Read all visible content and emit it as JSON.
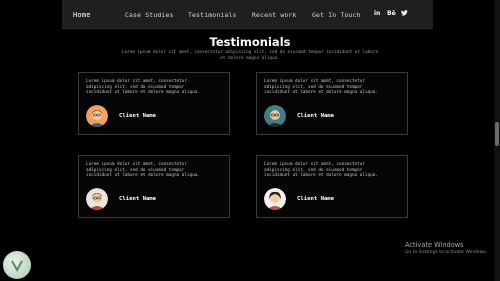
{
  "nav": {
    "home": "Home",
    "case_studies": "Case Studies",
    "testimonials": "Testimonials",
    "recent_work": "Recent work",
    "get_in_touch": "Get In Touch",
    "social_linkedin": "in",
    "social_behance": "Bē",
    "social_twitter": "🐦"
  },
  "section": {
    "title": "Testimonials",
    "subtitle": "Lorem ipsum dolor sit amet, consectetur adipiscing elit, sed do eiusmod tempor incididunt ut labore et dolore magna aliqua."
  },
  "testimonials": [
    {
      "quote": "Lorem ipsum dolor sit amet, consectetur adipiscing elit, sed do eiusmod tempor incididunt ut labore et dolore magna aliqua.",
      "client": "Client Name"
    },
    {
      "quote": "Lorem ipsum dolor sit amet, consectetur adipiscing elit, sed do eiusmod tempor incididunt ut labore et dolore magna aliqua.",
      "client": "Client Name"
    },
    {
      "quote": "Lorem ipsum dolor sit amet, consectetur adipiscing elit, sed do eiusmod tempor incididunt ut labore et dolore magna aliqua.",
      "client": "Client Name"
    },
    {
      "quote": "Lorem ipsum dolor sit amet, consectetur adipiscing elit, sed do eiusmod tempor incididunt ut labore et dolore magna aliqua.",
      "client": "Client Name"
    }
  ],
  "windows": {
    "activate_title": "Activate Windows",
    "activate_sub": "Go to Settings to activate Windows."
  },
  "colors": {
    "background": "#000000",
    "nav_bg": "#1f1f1f",
    "card_border": "#3a3a3a"
  }
}
